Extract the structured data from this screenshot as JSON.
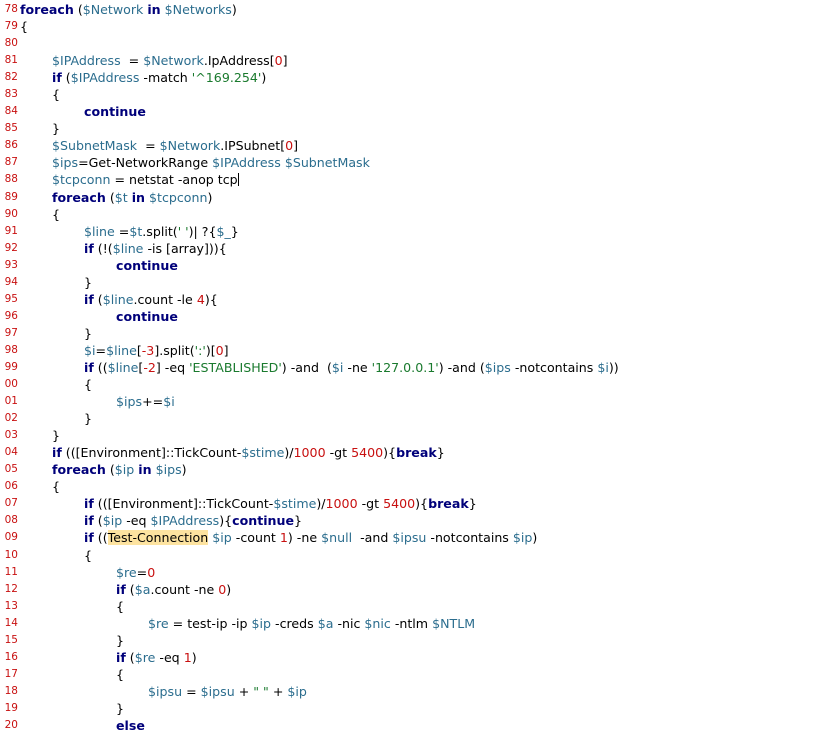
{
  "editor": {
    "lines": [
      {
        "n": "78",
        "indent": 0,
        "t": [
          {
            "c": "kw",
            "s": "foreach"
          },
          {
            "c": "pl",
            "s": " ("
          },
          {
            "c": "var",
            "s": "$Network"
          },
          {
            "c": "pl",
            "s": " "
          },
          {
            "c": "kw",
            "s": "in"
          },
          {
            "c": "pl",
            "s": " "
          },
          {
            "c": "var",
            "s": "$Networks"
          },
          {
            "c": "pl",
            "s": ")"
          }
        ]
      },
      {
        "n": "79",
        "indent": 0,
        "t": [
          {
            "c": "pl",
            "s": "{"
          }
        ]
      },
      {
        "n": "80",
        "indent": 0,
        "t": []
      },
      {
        "n": "81",
        "indent": 1,
        "t": [
          {
            "c": "var",
            "s": "$IPAddress"
          },
          {
            "c": "pl",
            "s": "  = "
          },
          {
            "c": "var",
            "s": "$Network"
          },
          {
            "c": "pl",
            "s": ".IpAddress["
          },
          {
            "c": "num",
            "s": "0"
          },
          {
            "c": "pl",
            "s": "]"
          }
        ]
      },
      {
        "n": "82",
        "indent": 1,
        "t": [
          {
            "c": "kw",
            "s": "if"
          },
          {
            "c": "pl",
            "s": " ("
          },
          {
            "c": "var",
            "s": "$IPAddress"
          },
          {
            "c": "pl",
            "s": " -match "
          },
          {
            "c": "str",
            "s": "'^169.254'"
          },
          {
            "c": "pl",
            "s": ")"
          }
        ]
      },
      {
        "n": "83",
        "indent": 1,
        "t": [
          {
            "c": "pl",
            "s": "{"
          }
        ]
      },
      {
        "n": "84",
        "indent": 2,
        "t": [
          {
            "c": "kw",
            "s": "continue"
          }
        ]
      },
      {
        "n": "85",
        "indent": 1,
        "t": [
          {
            "c": "pl",
            "s": "}"
          }
        ]
      },
      {
        "n": "86",
        "indent": 1,
        "t": [
          {
            "c": "var",
            "s": "$SubnetMask"
          },
          {
            "c": "pl",
            "s": "  = "
          },
          {
            "c": "var",
            "s": "$Network"
          },
          {
            "c": "pl",
            "s": ".IPSubnet["
          },
          {
            "c": "num",
            "s": "0"
          },
          {
            "c": "pl",
            "s": "]"
          }
        ]
      },
      {
        "n": "87",
        "indent": 1,
        "t": [
          {
            "c": "var",
            "s": "$ips"
          },
          {
            "c": "pl",
            "s": "=Get-NetworkRange "
          },
          {
            "c": "var",
            "s": "$IPAddress"
          },
          {
            "c": "pl",
            "s": " "
          },
          {
            "c": "var",
            "s": "$SubnetMask"
          }
        ]
      },
      {
        "n": "88",
        "indent": 1,
        "t": [
          {
            "c": "var",
            "s": "$tcpconn"
          },
          {
            "c": "pl",
            "s": " = netstat -anop tcp"
          },
          {
            "c": "caret",
            "s": ""
          }
        ]
      },
      {
        "n": "89",
        "indent": 1,
        "t": [
          {
            "c": "kw",
            "s": "foreach"
          },
          {
            "c": "pl",
            "s": " ("
          },
          {
            "c": "var",
            "s": "$t"
          },
          {
            "c": "pl",
            "s": " "
          },
          {
            "c": "kw",
            "s": "in"
          },
          {
            "c": "pl",
            "s": " "
          },
          {
            "c": "var",
            "s": "$tcpconn"
          },
          {
            "c": "pl",
            "s": ")"
          }
        ]
      },
      {
        "n": "90",
        "indent": 1,
        "t": [
          {
            "c": "pl",
            "s": "{"
          }
        ]
      },
      {
        "n": "91",
        "indent": 2,
        "t": [
          {
            "c": "var",
            "s": "$line"
          },
          {
            "c": "pl",
            "s": " ="
          },
          {
            "c": "var",
            "s": "$t"
          },
          {
            "c": "pl",
            "s": ".split("
          },
          {
            "c": "str",
            "s": "' '"
          },
          {
            "c": "pl",
            "s": ")| ?{"
          },
          {
            "c": "var",
            "s": "$_"
          },
          {
            "c": "pl",
            "s": "}"
          }
        ]
      },
      {
        "n": "92",
        "indent": 2,
        "t": [
          {
            "c": "kw",
            "s": "if"
          },
          {
            "c": "pl",
            "s": " (!("
          },
          {
            "c": "var",
            "s": "$line"
          },
          {
            "c": "pl",
            "s": " -is [array])){"
          }
        ]
      },
      {
        "n": "93",
        "indent": 3,
        "t": [
          {
            "c": "kw",
            "s": "continue"
          }
        ]
      },
      {
        "n": "94",
        "indent": 2,
        "t": [
          {
            "c": "pl",
            "s": "}"
          }
        ]
      },
      {
        "n": "95",
        "indent": 2,
        "t": [
          {
            "c": "kw",
            "s": "if"
          },
          {
            "c": "pl",
            "s": " ("
          },
          {
            "c": "var",
            "s": "$line"
          },
          {
            "c": "pl",
            "s": ".count -le "
          },
          {
            "c": "num",
            "s": "4"
          },
          {
            "c": "pl",
            "s": "){"
          }
        ]
      },
      {
        "n": "96",
        "indent": 3,
        "t": [
          {
            "c": "kw",
            "s": "continue"
          }
        ]
      },
      {
        "n": "97",
        "indent": 2,
        "t": [
          {
            "c": "pl",
            "s": "}"
          }
        ]
      },
      {
        "n": "98",
        "indent": 2,
        "t": [
          {
            "c": "var",
            "s": "$i"
          },
          {
            "c": "pl",
            "s": "="
          },
          {
            "c": "var",
            "s": "$line"
          },
          {
            "c": "pl",
            "s": "["
          },
          {
            "c": "num",
            "s": "-3"
          },
          {
            "c": "pl",
            "s": "].split("
          },
          {
            "c": "str",
            "s": "':'"
          },
          {
            "c": "pl",
            "s": ")["
          },
          {
            "c": "num",
            "s": "0"
          },
          {
            "c": "pl",
            "s": "]"
          }
        ]
      },
      {
        "n": "99",
        "indent": 2,
        "t": [
          {
            "c": "kw",
            "s": "if"
          },
          {
            "c": "pl",
            "s": " (("
          },
          {
            "c": "var",
            "s": "$line"
          },
          {
            "c": "pl",
            "s": "["
          },
          {
            "c": "num",
            "s": "-2"
          },
          {
            "c": "pl",
            "s": "] -eq "
          },
          {
            "c": "str",
            "s": "'ESTABLISHED'"
          },
          {
            "c": "pl",
            "s": ") -and  ("
          },
          {
            "c": "var",
            "s": "$i"
          },
          {
            "c": "pl",
            "s": " -ne "
          },
          {
            "c": "str",
            "s": "'127.0.0.1'"
          },
          {
            "c": "pl",
            "s": ") -and ("
          },
          {
            "c": "var",
            "s": "$ips"
          },
          {
            "c": "pl",
            "s": " -notcontains "
          },
          {
            "c": "var",
            "s": "$i"
          },
          {
            "c": "pl",
            "s": "))"
          }
        ]
      },
      {
        "n": "00",
        "indent": 2,
        "t": [
          {
            "c": "pl",
            "s": "{"
          }
        ]
      },
      {
        "n": "01",
        "indent": 3,
        "t": [
          {
            "c": "var",
            "s": "$ips"
          },
          {
            "c": "pl",
            "s": "+="
          },
          {
            "c": "var",
            "s": "$i"
          }
        ]
      },
      {
        "n": "02",
        "indent": 2,
        "t": [
          {
            "c": "pl",
            "s": "}"
          }
        ]
      },
      {
        "n": "03",
        "indent": 1,
        "t": [
          {
            "c": "pl",
            "s": "}"
          }
        ]
      },
      {
        "n": "04",
        "indent": 1,
        "t": [
          {
            "c": "kw",
            "s": "if"
          },
          {
            "c": "pl",
            "s": " (([Environment]::TickCount-"
          },
          {
            "c": "var",
            "s": "$stime"
          },
          {
            "c": "pl",
            "s": ")/"
          },
          {
            "c": "num",
            "s": "1000"
          },
          {
            "c": "pl",
            "s": " -gt "
          },
          {
            "c": "num",
            "s": "5400"
          },
          {
            "c": "pl",
            "s": "){"
          },
          {
            "c": "kw",
            "s": "break"
          },
          {
            "c": "pl",
            "s": "}"
          }
        ]
      },
      {
        "n": "05",
        "indent": 1,
        "t": [
          {
            "c": "kw",
            "s": "foreach"
          },
          {
            "c": "pl",
            "s": " ("
          },
          {
            "c": "var",
            "s": "$ip"
          },
          {
            "c": "pl",
            "s": " "
          },
          {
            "c": "kw",
            "s": "in"
          },
          {
            "c": "pl",
            "s": " "
          },
          {
            "c": "var",
            "s": "$ips"
          },
          {
            "c": "pl",
            "s": ")"
          }
        ]
      },
      {
        "n": "06",
        "indent": 1,
        "t": [
          {
            "c": "pl",
            "s": "{"
          }
        ]
      },
      {
        "n": "07",
        "indent": 2,
        "t": [
          {
            "c": "kw",
            "s": "if"
          },
          {
            "c": "pl",
            "s": " (([Environment]::TickCount-"
          },
          {
            "c": "var",
            "s": "$stime"
          },
          {
            "c": "pl",
            "s": ")/"
          },
          {
            "c": "num",
            "s": "1000"
          },
          {
            "c": "pl",
            "s": " -gt "
          },
          {
            "c": "num",
            "s": "5400"
          },
          {
            "c": "pl",
            "s": "){"
          },
          {
            "c": "kw",
            "s": "break"
          },
          {
            "c": "pl",
            "s": "}"
          }
        ]
      },
      {
        "n": "08",
        "indent": 2,
        "t": [
          {
            "c": "kw",
            "s": "if"
          },
          {
            "c": "pl",
            "s": " ("
          },
          {
            "c": "var",
            "s": "$ip"
          },
          {
            "c": "pl",
            "s": " -eq "
          },
          {
            "c": "var",
            "s": "$IPAddress"
          },
          {
            "c": "pl",
            "s": "){"
          },
          {
            "c": "kw",
            "s": "continue"
          },
          {
            "c": "pl",
            "s": "}"
          }
        ]
      },
      {
        "n": "09",
        "indent": 2,
        "t": [
          {
            "c": "kw",
            "s": "if"
          },
          {
            "c": "pl",
            "s": " (("
          },
          {
            "c": "hl",
            "s": "Test-Connection"
          },
          {
            "c": "pl",
            "s": " "
          },
          {
            "c": "var",
            "s": "$ip"
          },
          {
            "c": "pl",
            "s": " -count "
          },
          {
            "c": "num",
            "s": "1"
          },
          {
            "c": "pl",
            "s": ") -ne "
          },
          {
            "c": "var",
            "s": "$null"
          },
          {
            "c": "pl",
            "s": "  -and "
          },
          {
            "c": "var",
            "s": "$ipsu"
          },
          {
            "c": "pl",
            "s": " -notcontains "
          },
          {
            "c": "var",
            "s": "$ip"
          },
          {
            "c": "pl",
            "s": ")"
          }
        ]
      },
      {
        "n": "10",
        "indent": 2,
        "t": [
          {
            "c": "pl",
            "s": "{"
          }
        ]
      },
      {
        "n": "11",
        "indent": 3,
        "t": [
          {
            "c": "var",
            "s": "$re"
          },
          {
            "c": "pl",
            "s": "="
          },
          {
            "c": "num",
            "s": "0"
          }
        ]
      },
      {
        "n": "12",
        "indent": 3,
        "t": [
          {
            "c": "kw",
            "s": "if"
          },
          {
            "c": "pl",
            "s": " ("
          },
          {
            "c": "var",
            "s": "$a"
          },
          {
            "c": "pl",
            "s": ".count -ne "
          },
          {
            "c": "num",
            "s": "0"
          },
          {
            "c": "pl",
            "s": ")"
          }
        ]
      },
      {
        "n": "13",
        "indent": 3,
        "t": [
          {
            "c": "pl",
            "s": "{"
          }
        ]
      },
      {
        "n": "14",
        "indent": 4,
        "t": [
          {
            "c": "var",
            "s": "$re"
          },
          {
            "c": "pl",
            "s": " = test-ip -ip "
          },
          {
            "c": "var",
            "s": "$ip"
          },
          {
            "c": "pl",
            "s": " -creds "
          },
          {
            "c": "var",
            "s": "$a"
          },
          {
            "c": "pl",
            "s": " -nic "
          },
          {
            "c": "var",
            "s": "$nic"
          },
          {
            "c": "pl",
            "s": " -ntlm "
          },
          {
            "c": "var",
            "s": "$NTLM"
          }
        ]
      },
      {
        "n": "15",
        "indent": 3,
        "t": [
          {
            "c": "pl",
            "s": "}"
          }
        ]
      },
      {
        "n": "16",
        "indent": 3,
        "t": [
          {
            "c": "kw",
            "s": "if"
          },
          {
            "c": "pl",
            "s": " ("
          },
          {
            "c": "var",
            "s": "$re"
          },
          {
            "c": "pl",
            "s": " -eq "
          },
          {
            "c": "num",
            "s": "1"
          },
          {
            "c": "pl",
            "s": ")"
          }
        ]
      },
      {
        "n": "17",
        "indent": 3,
        "t": [
          {
            "c": "pl",
            "s": "{"
          }
        ]
      },
      {
        "n": "18",
        "indent": 4,
        "t": [
          {
            "c": "var",
            "s": "$ipsu"
          },
          {
            "c": "pl",
            "s": " = "
          },
          {
            "c": "var",
            "s": "$ipsu"
          },
          {
            "c": "pl",
            "s": " + "
          },
          {
            "c": "str",
            "s": "\" \""
          },
          {
            "c": "pl",
            "s": " + "
          },
          {
            "c": "var",
            "s": "$ip"
          }
        ]
      },
      {
        "n": "19",
        "indent": 3,
        "t": [
          {
            "c": "pl",
            "s": "}"
          }
        ]
      },
      {
        "n": "20",
        "indent": 3,
        "t": [
          {
            "c": "kw",
            "s": "else"
          }
        ]
      }
    ]
  }
}
